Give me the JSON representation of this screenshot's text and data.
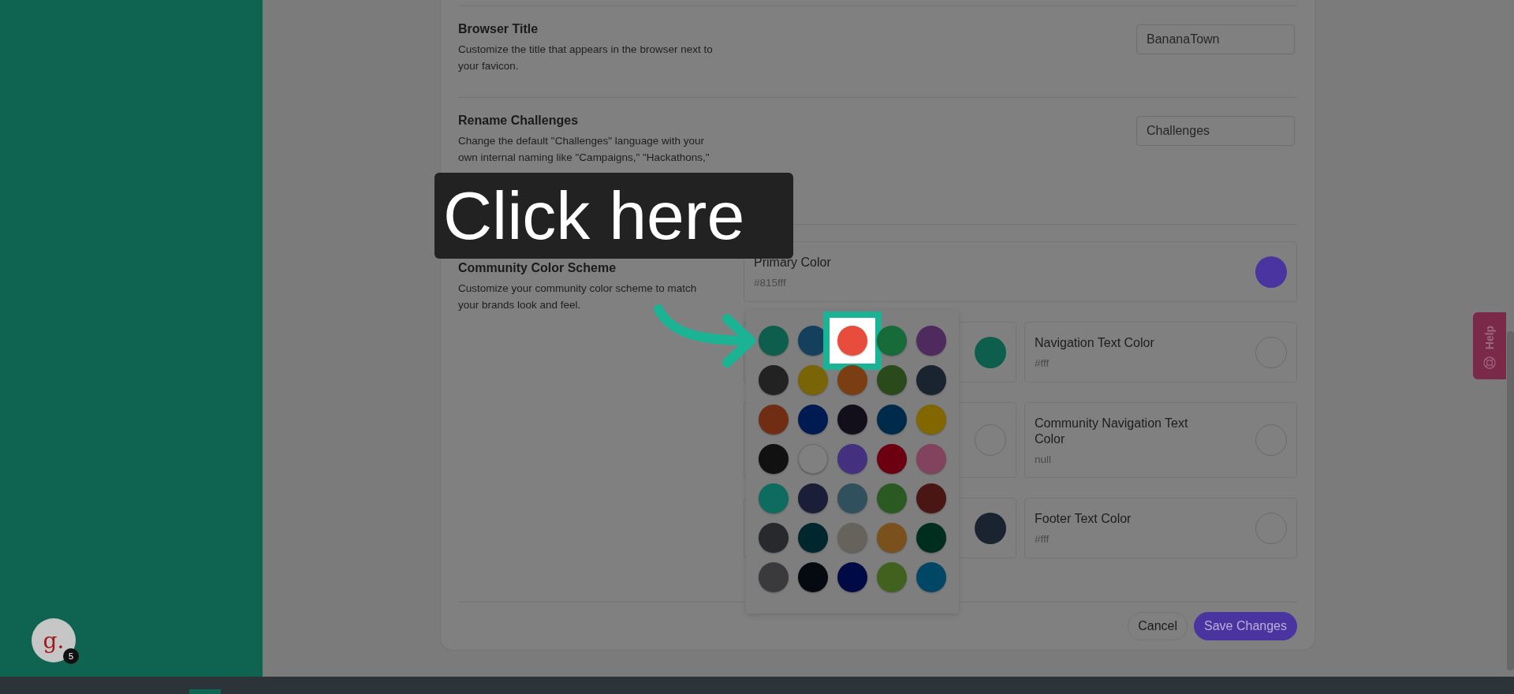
{
  "settings": [
    {
      "title": "Browser Title",
      "description": "Customize the title that appears in the browser next to your favicon.",
      "value": "BananaTown"
    },
    {
      "title": "Rename Challenges",
      "description": "Change the default \"Challenges\" language with your own internal naming like \"Campaigns,\" \"Hackathons,\"",
      "value": "Challenges"
    }
  ],
  "color_scheme": {
    "title": "Community Color Scheme",
    "description": "Customize your community color scheme to match your brands look and feel.",
    "primary": {
      "label": "Primary Color",
      "value": "#815fff",
      "color": "#4a35a0"
    },
    "cards": [
      {
        "color": "#0d5e4c"
      },
      {
        "label": "Navigation Text Color",
        "value": "#fff",
        "color": "#808080"
      },
      {
        "color": "#808080"
      },
      {
        "label": "Community Navigation Text Color",
        "value": "null",
        "color": "#808080"
      },
      {
        "color": "#1a2430"
      },
      {
        "label": "Footer Text Color",
        "value": "#fff",
        "color": "#808080"
      }
    ]
  },
  "palette": [
    {
      "color": "#0d5e4c",
      "selected": false
    },
    {
      "color": "#14405e",
      "selected": false
    },
    {
      "color": "#e84c3d",
      "selected": true
    },
    {
      "color": "#176b38",
      "selected": false
    },
    {
      "color": "#4f2a5e",
      "selected": false
    },
    {
      "color": "#222222",
      "selected": false
    },
    {
      "color": "#7a6408",
      "selected": false
    },
    {
      "color": "#7a3e12",
      "selected": false
    },
    {
      "color": "#2a4a1c",
      "selected": false
    },
    {
      "color": "#1a2430",
      "selected": false
    },
    {
      "color": "#702d14",
      "selected": false
    },
    {
      "color": "#001a52",
      "selected": false
    },
    {
      "color": "#120e1a",
      "selected": false
    },
    {
      "color": "#002a4a",
      "selected": false
    },
    {
      "color": "#826600",
      "selected": false
    },
    {
      "color": "#111111",
      "selected": false
    },
    {
      "color": "#808080",
      "selected": false
    },
    {
      "color": "#43307f",
      "selected": false
    },
    {
      "color": "#6c0010",
      "selected": false
    },
    {
      "color": "#82435e",
      "selected": false
    },
    {
      "color": "#0d6b60",
      "selected": false
    },
    {
      "color": "#1a1e38",
      "selected": false
    },
    {
      "color": "#30505e",
      "selected": false
    },
    {
      "color": "#2a5a22",
      "selected": false
    },
    {
      "color": "#4a1614",
      "selected": false
    },
    {
      "color": "#28292c",
      "selected": false
    },
    {
      "color": "#00262e",
      "selected": false
    },
    {
      "color": "#66625c",
      "selected": false
    },
    {
      "color": "#7a501c",
      "selected": false
    },
    {
      "color": "#002e1e",
      "selected": false
    },
    {
      "color": "#3a3a3c",
      "selected": false
    },
    {
      "color": "#050a10",
      "selected": false
    },
    {
      "color": "#000a45",
      "selected": false
    },
    {
      "color": "#41621e",
      "selected": false
    },
    {
      "color": "#004766",
      "selected": false
    }
  ],
  "buttons": [
    {
      "label": "Cancel",
      "kind": "secondary"
    },
    {
      "label": "Save Changes",
      "kind": "primary"
    }
  ],
  "tutorial": {
    "callout": "Click here"
  },
  "help_tab": {
    "label": "Help"
  },
  "avatar": {
    "initial": "g.",
    "badge": "5"
  }
}
